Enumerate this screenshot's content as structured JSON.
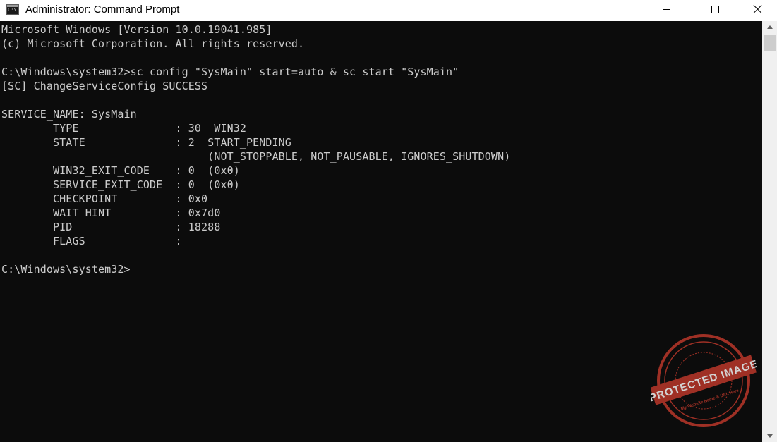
{
  "window": {
    "title": "Administrator: Command Prompt",
    "icon": "cmd-icon"
  },
  "controls": {
    "minimize_icon": "minimize-icon",
    "maximize_icon": "maximize-icon",
    "close_icon": "close-icon"
  },
  "console": {
    "background": "#0c0c0c",
    "foreground": "#cccccc",
    "lines": [
      "Microsoft Windows [Version 10.0.19041.985]",
      "(c) Microsoft Corporation. All rights reserved.",
      "",
      "C:\\Windows\\system32>sc config \"SysMain\" start=auto & sc start \"SysMain\"",
      "[SC] ChangeServiceConfig SUCCESS",
      "",
      "SERVICE_NAME: SysMain",
      "        TYPE               : 30  WIN32",
      "        STATE              : 2  START_PENDING",
      "                                (NOT_STOPPABLE, NOT_PAUSABLE, IGNORES_SHUTDOWN)",
      "        WIN32_EXIT_CODE    : 0  (0x0)",
      "        SERVICE_EXIT_CODE  : 0  (0x0)",
      "        CHECKPOINT         : 0x0",
      "        WAIT_HINT          : 0x7d0",
      "        PID                : 18288",
      "        FLAGS              :",
      "",
      "C:\\Windows\\system32>"
    ]
  },
  "watermark": {
    "text": "PROTECTED IMAGE",
    "subtext": "My Website Name & URL Here",
    "color": "#c0392b"
  }
}
